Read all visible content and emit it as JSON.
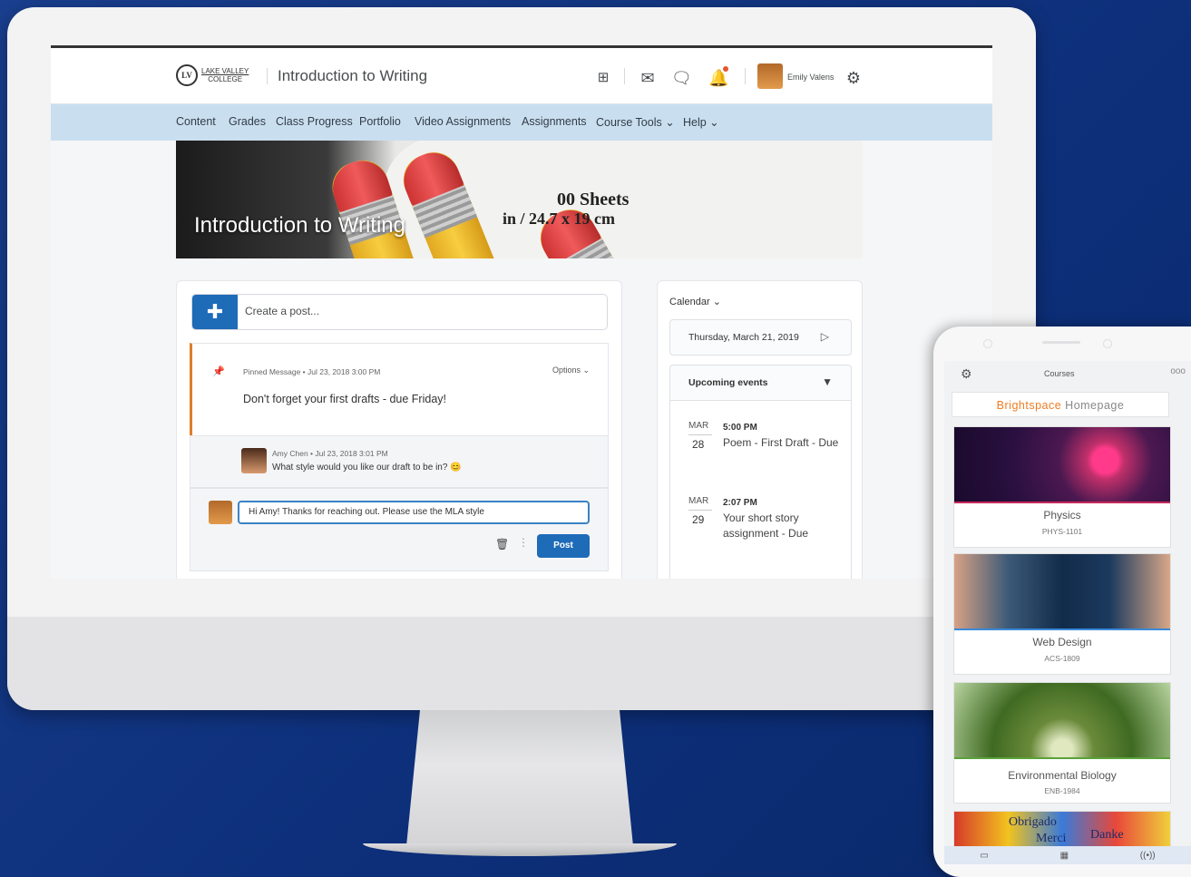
{
  "header": {
    "logo_main": "LAKE VALLEY",
    "logo_sub": "COLLEGE",
    "logo_mark": "LV",
    "course_title": "Introduction to Writing",
    "user_name": "Emily Valens"
  },
  "subnav": {
    "items": [
      "Content",
      "Grades",
      "Class Progress",
      "Portfolio",
      "Video Assignments",
      "Assignments",
      "Course Tools ⌄",
      "Help ⌄"
    ]
  },
  "hero": {
    "title": "Introduction to Writing",
    "print_line1": "00 Sheets",
    "print_line2": "in / 24.7 x 19 cm"
  },
  "feed": {
    "create_placeholder": "Create a post...",
    "pinned_meta": "Pinned Message • Jul 23, 2018 3:00 PM",
    "options_label": "Options ⌄",
    "pinned_message": "Don't forget your first drafts - due Friday!",
    "reply_meta": "Amy Chen • Jul 23, 2018 3:01 PM",
    "reply_message": "What style would you like our draft to be in? 😊",
    "compose_value": "Hi Amy! Thanks for reaching out. Please use the MLA style",
    "post_button": "Post"
  },
  "calendar": {
    "header": "Calendar ⌄",
    "date": "Thursday, March 21, 2019",
    "upcoming_label": "Upcoming events",
    "events": [
      {
        "month": "MAR",
        "day": "28",
        "time": "5:00 PM",
        "title": "Poem - First Draft - Due"
      },
      {
        "month": "MAR",
        "day": "29",
        "time": "2:07 PM",
        "title": "Your short story assignment - Due"
      }
    ]
  },
  "phone": {
    "header_title": "Courses",
    "home_brand": "Brightspace",
    "home_rest": " Homepage",
    "courses": [
      {
        "name": "Physics",
        "code": "PHYS-1101"
      },
      {
        "name": "Web Design",
        "code": "ACS-1809"
      },
      {
        "name": "Environmental Biology",
        "code": "ENB-1984"
      }
    ],
    "lang_words": [
      "Obrigado",
      "Merci",
      "Danke"
    ]
  }
}
